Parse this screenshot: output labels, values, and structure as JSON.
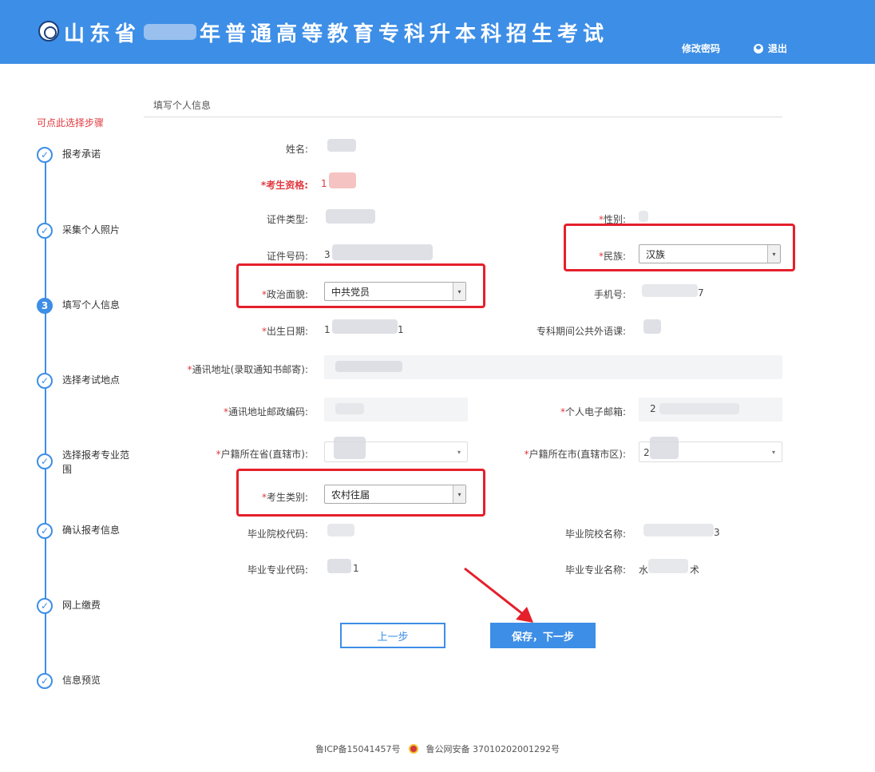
{
  "header": {
    "title_before": "山东省",
    "title_after": "年普通高等教育专科升本科招生考试",
    "change_password": "修改密码",
    "logout": "退出"
  },
  "sidebar": {
    "hint": "可点此选择步骤",
    "steps": [
      {
        "label": "报考承诺",
        "marker": ""
      },
      {
        "label": "采集个人照片",
        "marker": ""
      },
      {
        "label": "填写个人信息",
        "marker": "3"
      },
      {
        "label": "选择考试地点",
        "marker": ""
      },
      {
        "label": "选择报考专业范围",
        "marker": ""
      },
      {
        "label": "确认报考信息",
        "marker": ""
      },
      {
        "label": "网上缴费",
        "marker": ""
      },
      {
        "label": "信息预览",
        "marker": ""
      }
    ]
  },
  "form": {
    "section_title": "填写个人信息",
    "labels": {
      "name": "姓名:",
      "qualification": "考生资格:",
      "id_type": "证件类型:",
      "gender": "性别:",
      "id_number": "证件号码:",
      "ethnicity": "民族:",
      "politics": "政治面貌:",
      "phone": "手机号:",
      "birth": "出生日期:",
      "foreign_lang": "专科期间公共外语课:",
      "address": "通讯地址(录取通知书邮寄):",
      "postcode": "通讯地址邮政编码:",
      "email": "个人电子邮箱:",
      "hukou_prov": "户籍所在省(直辖市):",
      "hukou_city": "户籍所在市(直辖市区):",
      "category": "考生类别:",
      "school_code": "毕业院校代码:",
      "school_name": "毕业院校名称:",
      "major_code": "毕业专业代码:",
      "major_name": "毕业专业名称:"
    },
    "values": {
      "ethnicity": "汉族",
      "politics": "中共党员",
      "category": "农村往届",
      "qualification_prefix": "1",
      "id_number_prefix": "3",
      "birth_prefix": "1",
      "birth_suffix": "1",
      "phone_suffix": "7",
      "email_prefix": "2",
      "city_prefix": "2",
      "school_name_suffix": "3",
      "major_code_suffix": "1",
      "major_name_prefix": "水",
      "major_name_suffix": "术"
    },
    "required_mark": "*"
  },
  "buttons": {
    "prev": "上一步",
    "next": "保存，下一步"
  },
  "footer": {
    "icp": "鲁ICP备15041457号",
    "police": "鲁公网安备 37010202001292号"
  },
  "colors": {
    "primary": "#3d8ee6",
    "highlight": "#e5202b",
    "required": "#e0393e"
  }
}
